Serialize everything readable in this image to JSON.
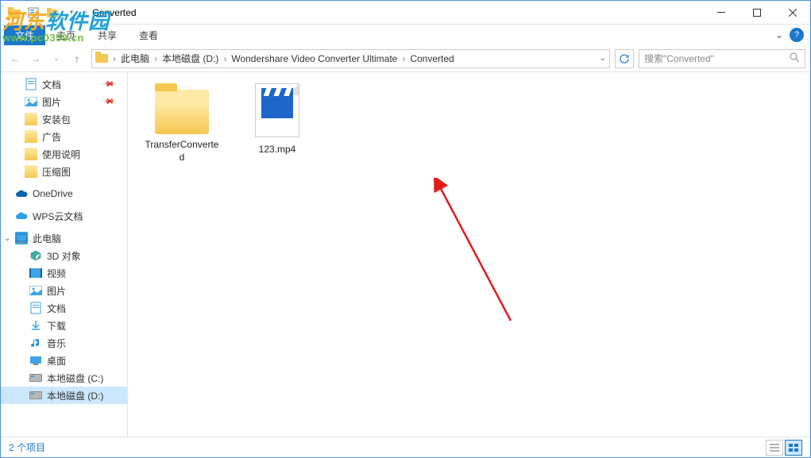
{
  "window": {
    "title": "Converted"
  },
  "ribbon": {
    "file": "文件",
    "tabs": [
      "主页",
      "共享",
      "查看"
    ]
  },
  "breadcrumb": {
    "parts": [
      "此电脑",
      "本地磁盘 (D:)",
      "Wondershare Video Converter Ultimate",
      "Converted"
    ]
  },
  "search": {
    "placeholder": "搜索\"Converted\""
  },
  "sidebar": {
    "quick": [
      {
        "label": "文档",
        "icon": "doc",
        "pinned": true
      },
      {
        "label": "图片",
        "icon": "pic",
        "pinned": true
      },
      {
        "label": "安装包",
        "icon": "folder"
      },
      {
        "label": "广告",
        "icon": "folder"
      },
      {
        "label": "使用说明",
        "icon": "folder"
      },
      {
        "label": "压缩图",
        "icon": "folder"
      }
    ],
    "onedrive": "OneDrive",
    "wps": "WPS云文档",
    "pc": "此电脑",
    "pc_children": [
      {
        "label": "3D 对象",
        "icon": "3d"
      },
      {
        "label": "视频",
        "icon": "video"
      },
      {
        "label": "图片",
        "icon": "pic"
      },
      {
        "label": "文档",
        "icon": "doc"
      },
      {
        "label": "下载",
        "icon": "dl"
      },
      {
        "label": "音乐",
        "icon": "music"
      },
      {
        "label": "桌面",
        "icon": "desktop"
      },
      {
        "label": "本地磁盘 (C:)",
        "icon": "disk"
      },
      {
        "label": "本地磁盘 (D:)",
        "icon": "disk",
        "selected": true
      }
    ]
  },
  "files": [
    {
      "name": "TransferConverted",
      "type": "folder"
    },
    {
      "name": "123.mp4",
      "type": "video"
    }
  ],
  "status": {
    "text": "2 个项目"
  },
  "watermark": {
    "name": "河东软件园",
    "url": "www.pc0359.cn"
  }
}
